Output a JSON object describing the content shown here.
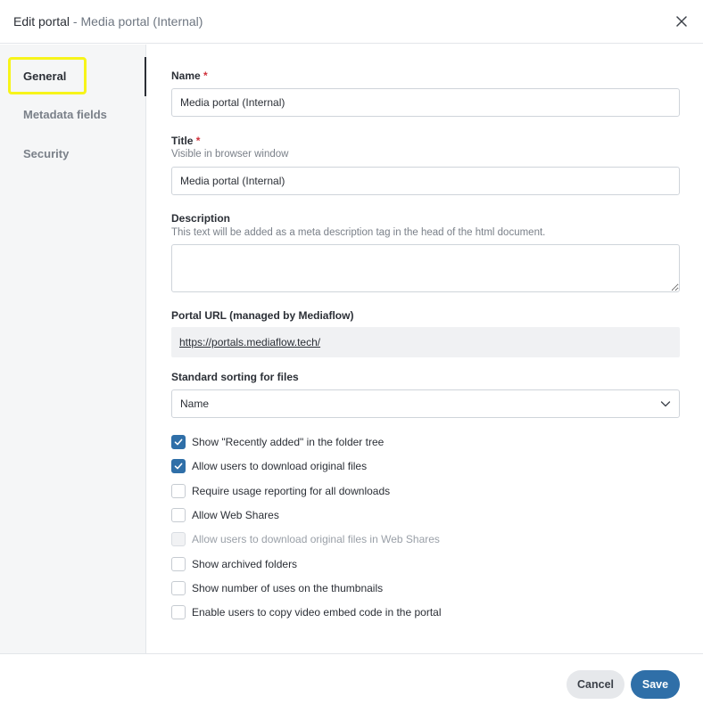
{
  "header": {
    "title": "Edit portal",
    "separator": " - ",
    "subtitle": "Media portal (Internal)"
  },
  "sidebar": {
    "items": [
      {
        "label": "General",
        "active": true
      },
      {
        "label": "Metadata fields",
        "active": false
      },
      {
        "label": "Security",
        "active": false
      }
    ]
  },
  "form": {
    "name": {
      "label": "Name",
      "required": "*",
      "value": "Media portal (Internal)"
    },
    "title": {
      "label": "Title",
      "required": "*",
      "hint": "Visible in browser window",
      "value": "Media portal (Internal)"
    },
    "description": {
      "label": "Description",
      "hint": "This text will be added as a meta description tag in the head of the html document.",
      "value": ""
    },
    "portal_url": {
      "label": "Portal URL (managed by Mediaflow)",
      "value": "https://portals.mediaflow.tech/"
    },
    "sorting": {
      "label": "Standard sorting for files",
      "value": "Name"
    },
    "checkboxes": [
      {
        "label": "Show \"Recently added\" in the folder tree",
        "checked": true,
        "disabled": false
      },
      {
        "label": "Allow users to download original files",
        "checked": true,
        "disabled": false
      },
      {
        "label": "Require usage reporting for all downloads",
        "checked": false,
        "disabled": false
      },
      {
        "label": "Allow Web Shares",
        "checked": false,
        "disabled": false
      },
      {
        "label": "Allow users to download original files in Web Shares",
        "checked": false,
        "disabled": true
      },
      {
        "label": "Show archived folders",
        "checked": false,
        "disabled": false
      },
      {
        "label": "Show number of uses on the thumbnails",
        "checked": false,
        "disabled": false
      },
      {
        "label": "Enable users to copy video embed code in the portal",
        "checked": false,
        "disabled": false
      }
    ]
  },
  "footer": {
    "cancel_label": "Cancel",
    "save_label": "Save"
  },
  "colors": {
    "accent": "#2f6fa8",
    "highlight": "#f7f41a",
    "required": "#d0313b"
  }
}
